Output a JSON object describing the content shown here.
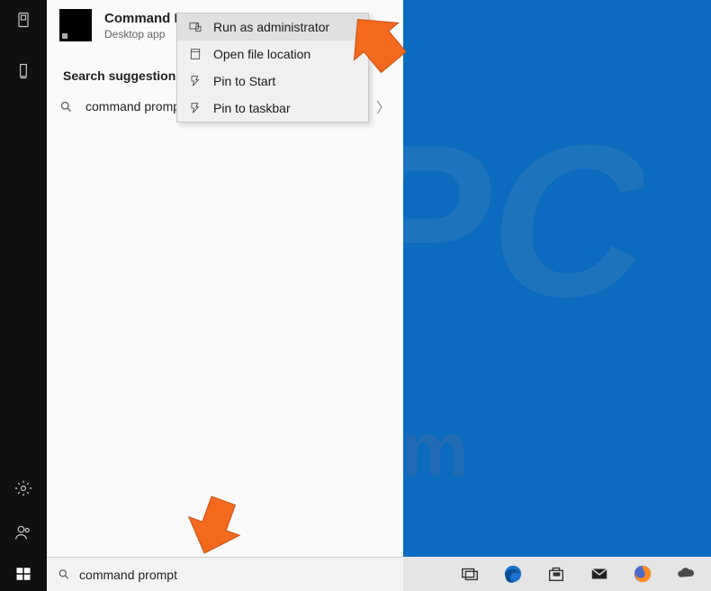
{
  "best_match": {
    "title": "Command Prompt",
    "subtitle": "Desktop app"
  },
  "section_label": "Search suggestions",
  "suggestion": "command prompt",
  "context_menu": {
    "run_admin": "Run as administrator",
    "open_loc": "Open file location",
    "pin_start": "Pin to Start",
    "pin_taskbar": "Pin to taskbar"
  },
  "search_value": "command prompt",
  "colors": {
    "desktop": "#0a6bbf",
    "arrow": "#f36a1f"
  }
}
